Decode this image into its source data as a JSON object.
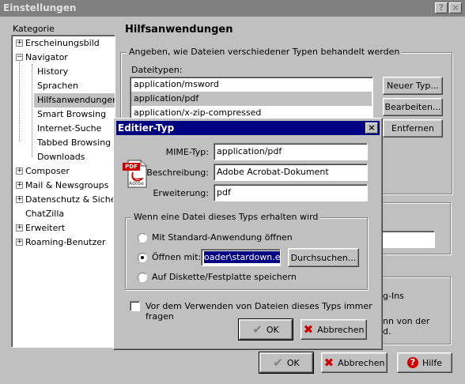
{
  "window": {
    "title": "Einstellungen",
    "help_btn": "?",
    "close_btn": "×"
  },
  "sidebar": {
    "label": "Kategorie",
    "items": [
      {
        "label": "Erscheinungsbild",
        "expander": "+"
      },
      {
        "label": "Navigator",
        "expander": "−"
      },
      {
        "label": "History"
      },
      {
        "label": "Sprachen"
      },
      {
        "label": "Hilfsanwendungen"
      },
      {
        "label": "Smart Browsing"
      },
      {
        "label": "Internet-Suche"
      },
      {
        "label": "Tabbed Browsing"
      },
      {
        "label": "Downloads"
      },
      {
        "label": "Composer",
        "expander": "+"
      },
      {
        "label": "Mail & Newsgroups",
        "expander": "+"
      },
      {
        "label": "Datenschutz & Sicherhe",
        "expander": "+"
      },
      {
        "label": "ChatZilla"
      },
      {
        "label": "Erweitert",
        "expander": "+"
      },
      {
        "label": "Roaming-Benutzer",
        "expander": "+"
      }
    ]
  },
  "main": {
    "heading": "Hilfsanwendungen",
    "group_label": "Angeben, wie Dateien verschiedener Typen behandelt werden",
    "types_label": "Dateitypen:",
    "types": [
      "application/msword",
      "application/pdf",
      "application/x-zip-compressed"
    ],
    "btn_new": "Neuer Typ...",
    "btn_edit": "Bearbeiten...",
    "btn_remove": "Entfernen",
    "partial_text_1": "g-Ins",
    "partial_text_2": "nn von der",
    "partial_text_3": "d."
  },
  "footer": {
    "ok": "OK",
    "cancel": "Abbrechen",
    "help": "Hilfe"
  },
  "dialog": {
    "title": "Editier-Typ",
    "close": "×",
    "mime_label": "MIME-Typ:",
    "mime_value": "application/pdf",
    "desc_label": "Beschreibung:",
    "desc_value": "Adobe Acrobat-Dokument",
    "ext_label": "Erweiterung:",
    "ext_value": "pdf",
    "icon_text": "PDF",
    "icon_brand": "Adobe",
    "group_label": "Wenn eine Datei dieses Typs erhalten wird",
    "opt_default": "Mit Standard-Anwendung öffnen",
    "opt_open_with": "Öffnen mit:",
    "open_with_value": "oader\\stardown.exe",
    "btn_browse": "Durchsuchen...",
    "opt_save": "Auf Diskette/Festplatte speichern",
    "always_ask": "Vor dem Verwenden von Dateien dieses Typs immer fragen",
    "ok": "OK",
    "cancel": "Abbrechen"
  },
  "colors": {
    "titlebar_active": "#000080",
    "titlebar_inactive": "#808080",
    "face": "#c0c0c0",
    "cancel_x": "#cc0000",
    "ok_check": "#808080"
  }
}
